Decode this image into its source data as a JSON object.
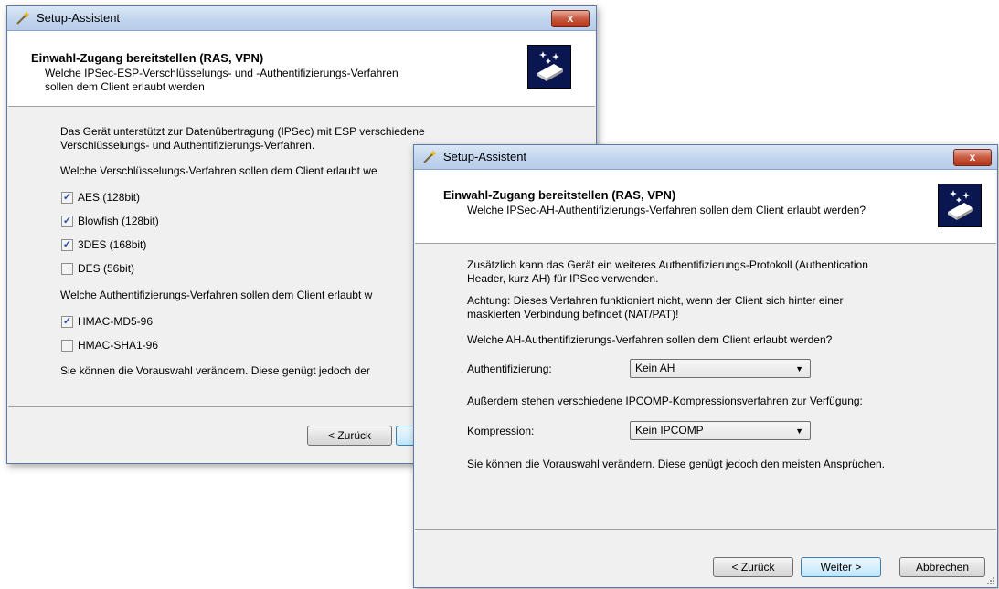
{
  "back_dialog": {
    "title": "Setup-Assistent",
    "close_label": "x",
    "header_title": "Einwahl-Zugang bereitstellen (RAS, VPN)",
    "header_sub_line1": "Welche IPSec-ESP-Verschlüsselungs- und -Authentifizierungs-Verfahren",
    "header_sub_line2": "sollen dem Client erlaubt werden",
    "intro_line1": "Das Gerät unterstützt zur Datenübertragung (IPSec) mit ESP verschiedene",
    "intro_line2": "Verschlüsselungs- und Authentifizierungs-Verfahren.",
    "enc_question": "Welche Verschlüsselungs-Verfahren sollen dem Client erlaubt we",
    "enc_options": [
      {
        "label": "AES (128bit)",
        "checked": true
      },
      {
        "label": "Blowfish (128bit)",
        "checked": true
      },
      {
        "label": "3DES (168bit)",
        "checked": true
      },
      {
        "label": "DES (56bit)",
        "checked": false
      }
    ],
    "auth_question": "Welche Authentifizierungs-Verfahren sollen dem Client erlaubt w",
    "auth_options": [
      {
        "label": "HMAC-MD5-96",
        "checked": true
      },
      {
        "label": "HMAC-SHA1-96",
        "checked": false
      }
    ],
    "footer_text": "Sie können die Vorauswahl verändern. Diese genügt jedoch der",
    "back_button": "< Zurück"
  },
  "front_dialog": {
    "title": "Setup-Assistent",
    "close_label": "x",
    "header_title": "Einwahl-Zugang bereitstellen (RAS, VPN)",
    "header_sub": "Welche IPSec-AH-Authentifizierungs-Verfahren sollen dem Client erlaubt werden?",
    "intro_line1": "Zusätzlich kann das Gerät ein weiteres Authentifizierungs-Protokoll (Authentication",
    "intro_line2": "Header, kurz AH) für IPSec verwenden.",
    "warning_line1": "Achtung: Dieses Verfahren funktioniert nicht, wenn der Client sich hinter einer",
    "warning_line2": "maskierten Verbindung befindet (NAT/PAT)!",
    "ah_question": "Welche AH-Authentifizierungs-Verfahren sollen dem Client erlaubt werden?",
    "auth_label": "Authentifizierung:",
    "auth_value": "Kein AH",
    "ipcomp_text": "Außerdem stehen verschiedene IPCOMP-Kompressionsverfahren zur Verfügung:",
    "compression_label": "Kompression:",
    "compression_value": "Kein IPCOMP",
    "footer_text": "Sie können die Vorauswahl verändern. Diese genügt jedoch den meisten Ansprüchen.",
    "back_button": "< Zurück",
    "next_button": "Weiter >",
    "cancel_button": "Abbrechen"
  }
}
